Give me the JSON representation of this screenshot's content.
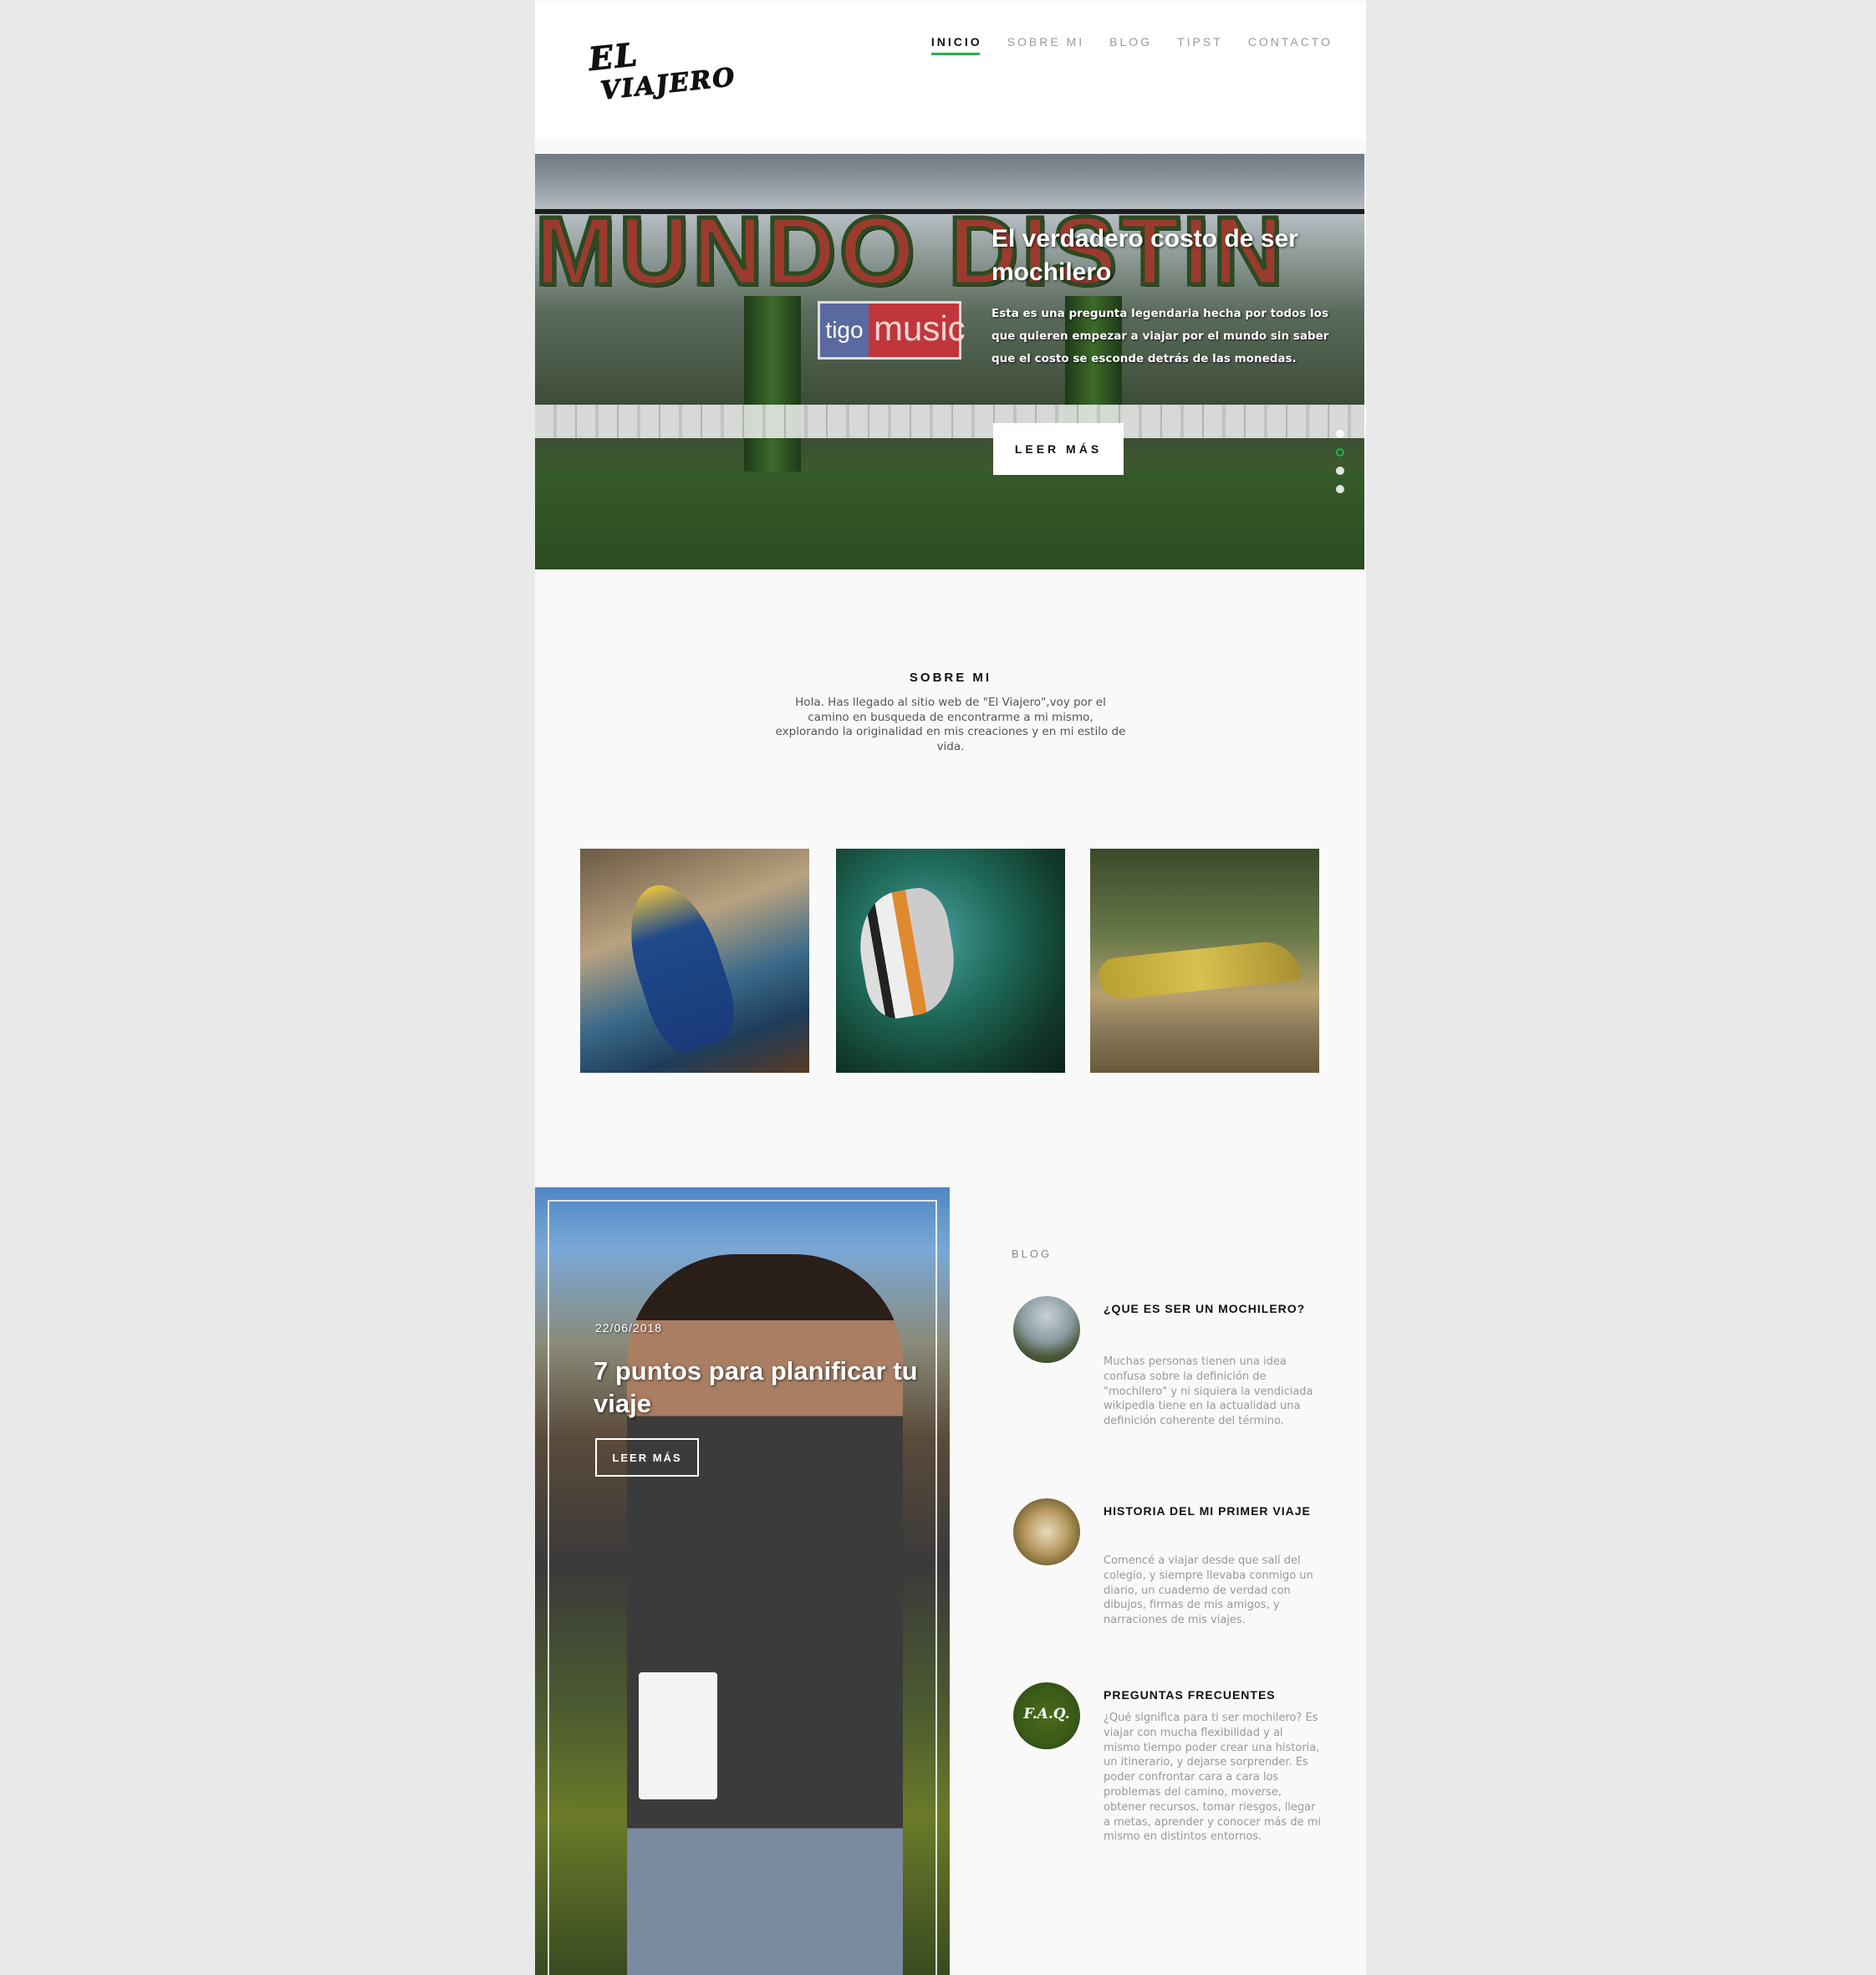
{
  "brand": {
    "logo_line1": "EL",
    "logo_line2": "VIAJERO"
  },
  "nav": {
    "items": [
      {
        "label": "INICIO",
        "active": true
      },
      {
        "label": "SOBRE MI",
        "active": false
      },
      {
        "label": "BLOG",
        "active": false
      },
      {
        "label": "TIPST",
        "active": false
      },
      {
        "label": "CONTACTO",
        "active": false
      }
    ]
  },
  "hero": {
    "title": "El verdadero costo de ser mochilero",
    "subtitle": "Esta es una pregunta legendaria hecha por todos los que quieren empezar a viajar por el mundo sin saber que el costo se esconde detrás de las monedas.",
    "button_label": "LEER MÁS",
    "photo_sign": "MUNDO DISTIN",
    "banner_brand": "tigo",
    "banner_text": "music",
    "slides": 4,
    "active_slide": 2
  },
  "about": {
    "title": "SOBRE MI",
    "text": "Hola. Has llegado al sitio web de \"El Viajero\",voy por el camino en busqueda de encontrarme a mi mismo, explorando la originalidad en mis creaciones y en mi estilo de vida."
  },
  "featured": {
    "date": "22/06/2018",
    "title": "7 puntos para planificar tu viaje",
    "button_label": "LEER MÁS"
  },
  "blog": {
    "label": "BLOG",
    "posts": [
      {
        "title": "¿QUE ES SER UN MOCHILERO?",
        "desc": "Muchas personas tienen una idea confusa sobre la definición de \"mochilero\" y ni siquiera la vendiciada wikipedia tiene en la actualidad una definición coherente del término."
      },
      {
        "title": "HISTORIA DEL MI PRIMER VIAJE",
        "desc": "Comencé a viajar desde que salí del colegio, y siempre llevaba conmigo un diario, un cuaderno de verdad con dibujos, firmas de mis amigos, y narraciones de mis viajes."
      },
      {
        "title": "PREGUNTAS FRECUENTES",
        "thumb_text": "F.A.Q.",
        "desc": "¿Qué significa para ti ser mochilero? Es viajar con mucha flexibilidad y al mismo tiempo poder crear una historia, un itinerario, y dejarse sorprender. Es poder confrontar cara a cara los problemas del camino, moverse, obtener recursos, tomar riesgos, llegar a metas, aprender y conocer más de mi mismo en distintos entornos."
      }
    ]
  },
  "colors": {
    "accent": "#1fb84a",
    "page_bg": "#e9e9e9",
    "content_bg": "#f9f9f9"
  }
}
